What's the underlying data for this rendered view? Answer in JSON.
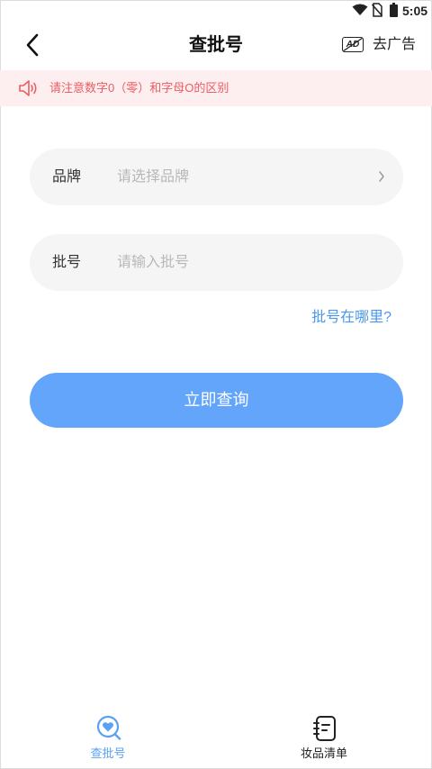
{
  "status_bar": {
    "time": "5:05"
  },
  "header": {
    "title": "查批号",
    "ad_badge": "AD",
    "ad_label": "去广告"
  },
  "notice": {
    "text": "请注意数字0（零）和字母O的区别"
  },
  "form": {
    "brand": {
      "label": "品牌",
      "placeholder": "请选择品牌",
      "value": ""
    },
    "batch": {
      "label": "批号",
      "placeholder": "请输入批号",
      "value": ""
    },
    "help_link": "批号在哪里?"
  },
  "submit_label": "立即查询",
  "tabbar": {
    "items": [
      {
        "label": "查批号",
        "icon": "search-heart-icon",
        "active": true
      },
      {
        "label": "妆品清单",
        "icon": "notebook-icon",
        "active": false
      }
    ]
  },
  "colors": {
    "accent": "#63a5fa",
    "link": "#4a97ee",
    "notice_text": "#ef5b5f",
    "notice_bg": "#fdeff0",
    "field_bg": "#f5f5f5"
  }
}
